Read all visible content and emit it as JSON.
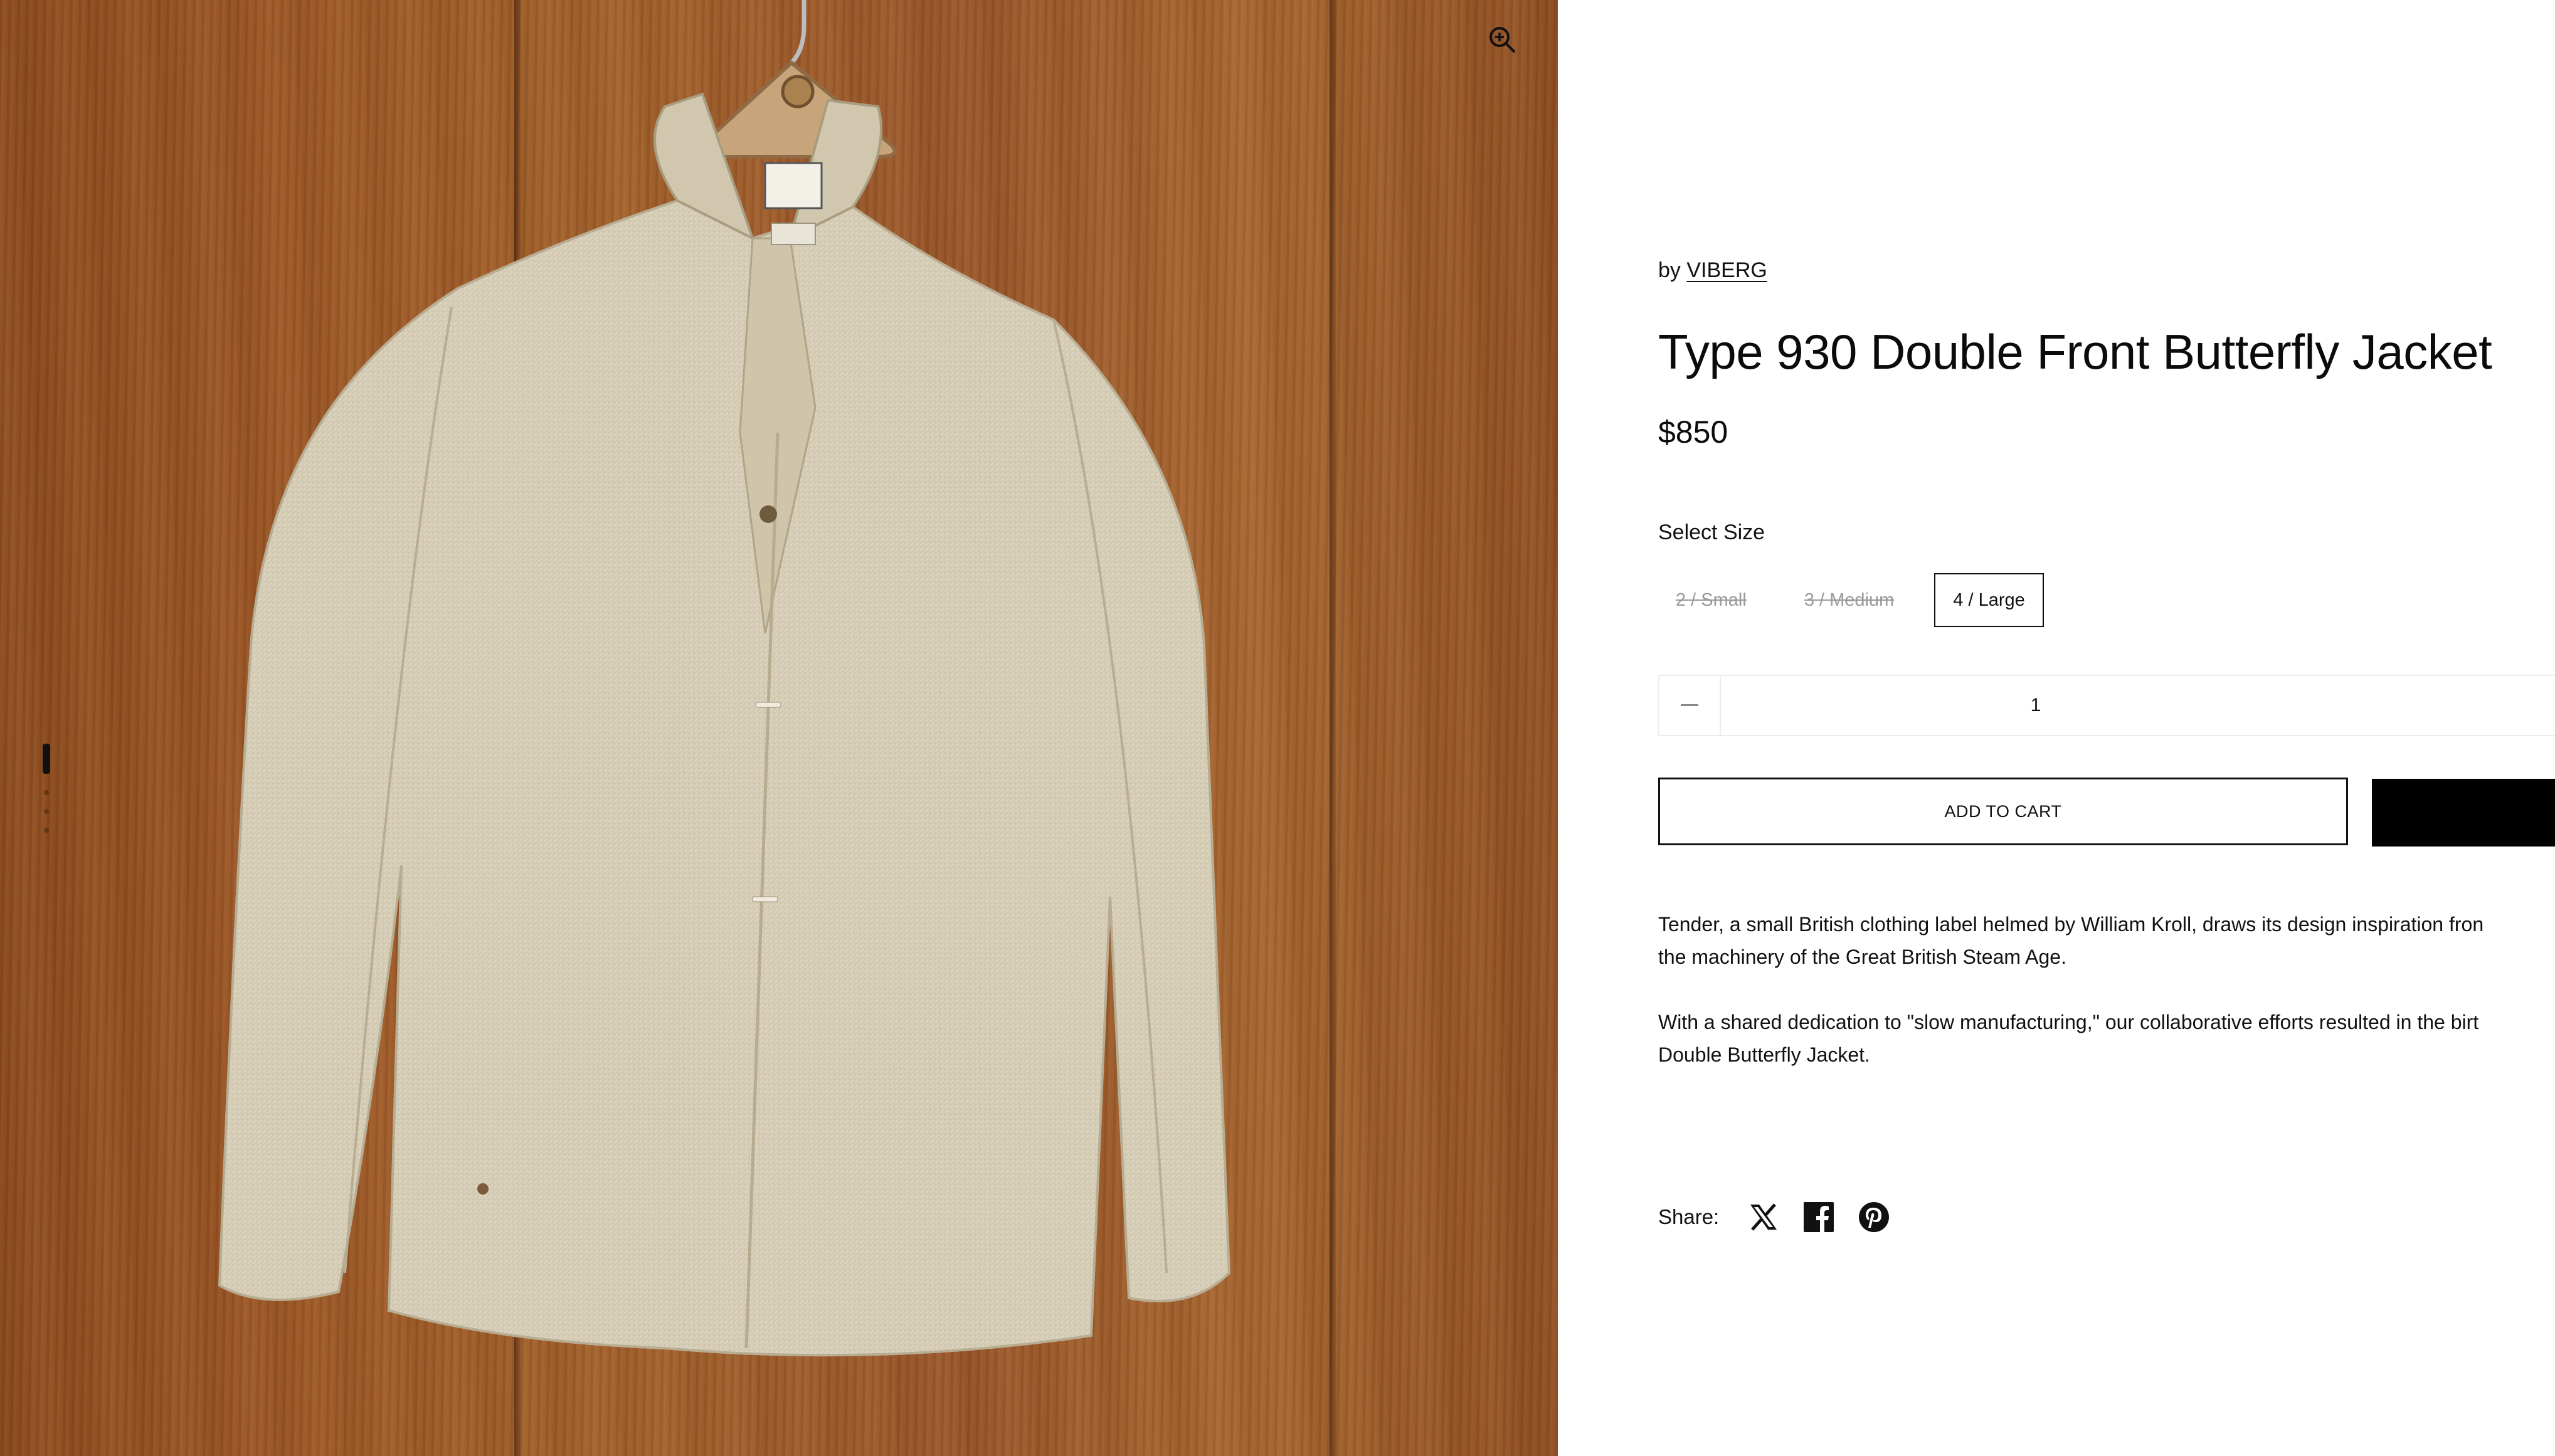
{
  "gallery": {
    "zoom_icon": "zoom-in-icon",
    "image_subject": "jacket-photo"
  },
  "product": {
    "vendor_prefix": "by",
    "vendor": "VIBERG",
    "title": "Type 930 Double Front Butterfly Jacket",
    "price": "$850"
  },
  "size": {
    "label": "Select Size",
    "options": [
      {
        "label": "2 / Small",
        "available": false
      },
      {
        "label": "3 / Medium",
        "available": false
      },
      {
        "label": "4 / Large",
        "available": true,
        "selected": true
      }
    ]
  },
  "quantity": {
    "value": "1",
    "minus_icon": "minus-icon"
  },
  "actions": {
    "add_to_cart": "ADD TO CART"
  },
  "description": {
    "paragraphs": [
      [
        "Tender, a small British clothing label helmed by William Kroll, draws its design inspiration fron",
        "the machinery of the Great British Steam Age."
      ],
      [
        "With a shared dedication to \"slow manufacturing,\" our collaborative efforts resulted in the birt",
        "Double Butterfly Jacket."
      ]
    ]
  },
  "share": {
    "label": "Share:",
    "icons": [
      "x-icon",
      "facebook-icon",
      "pinterest-icon"
    ]
  },
  "colors": {
    "wood": "#9a5626",
    "jacket": "#d8cfb8",
    "text": "#111111",
    "disabled_text": "#9a9a9a",
    "buy_button": "#000000"
  }
}
